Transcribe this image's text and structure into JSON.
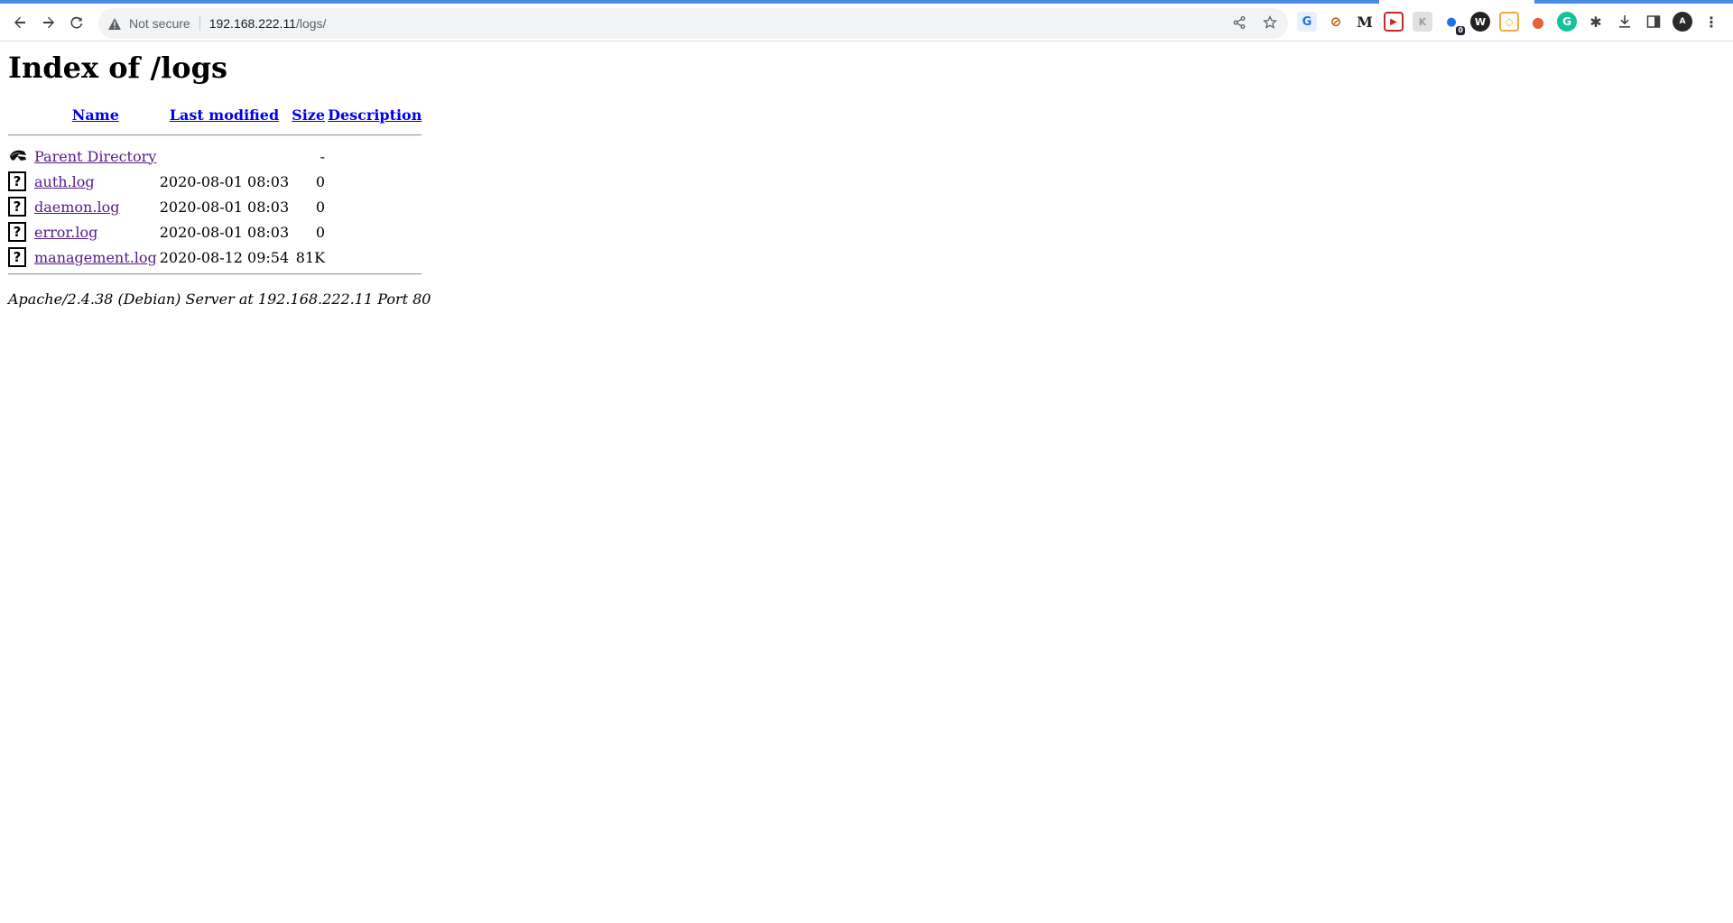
{
  "browser": {
    "security_label": "Not secure",
    "url_host": "192.168.222.11",
    "url_path": "/logs/",
    "extension_badge": "0"
  },
  "page": {
    "title": "Index of /logs",
    "columns": {
      "name": "Name",
      "last_modified": "Last modified",
      "size": "Size",
      "description": "Description"
    },
    "parent": {
      "label": "Parent Directory",
      "size": "-"
    },
    "rows": [
      {
        "name": "auth.log",
        "modified": "2020-08-01 08:03",
        "size": "0"
      },
      {
        "name": "daemon.log",
        "modified": "2020-08-01 08:03",
        "size": "0"
      },
      {
        "name": "error.log",
        "modified": "2020-08-01 08:03",
        "size": "0"
      },
      {
        "name": "management.log",
        "modified": "2020-08-12 09:54",
        "size": "81K"
      }
    ],
    "footer": "Apache/2.4.38 (Debian) Server at 192.168.222.11 Port 80"
  },
  "icons": {
    "unknown_file": "?"
  },
  "colors": {
    "link": "#0000ee",
    "visited_link": "#551a8b",
    "progress": "#4a8ae0"
  }
}
